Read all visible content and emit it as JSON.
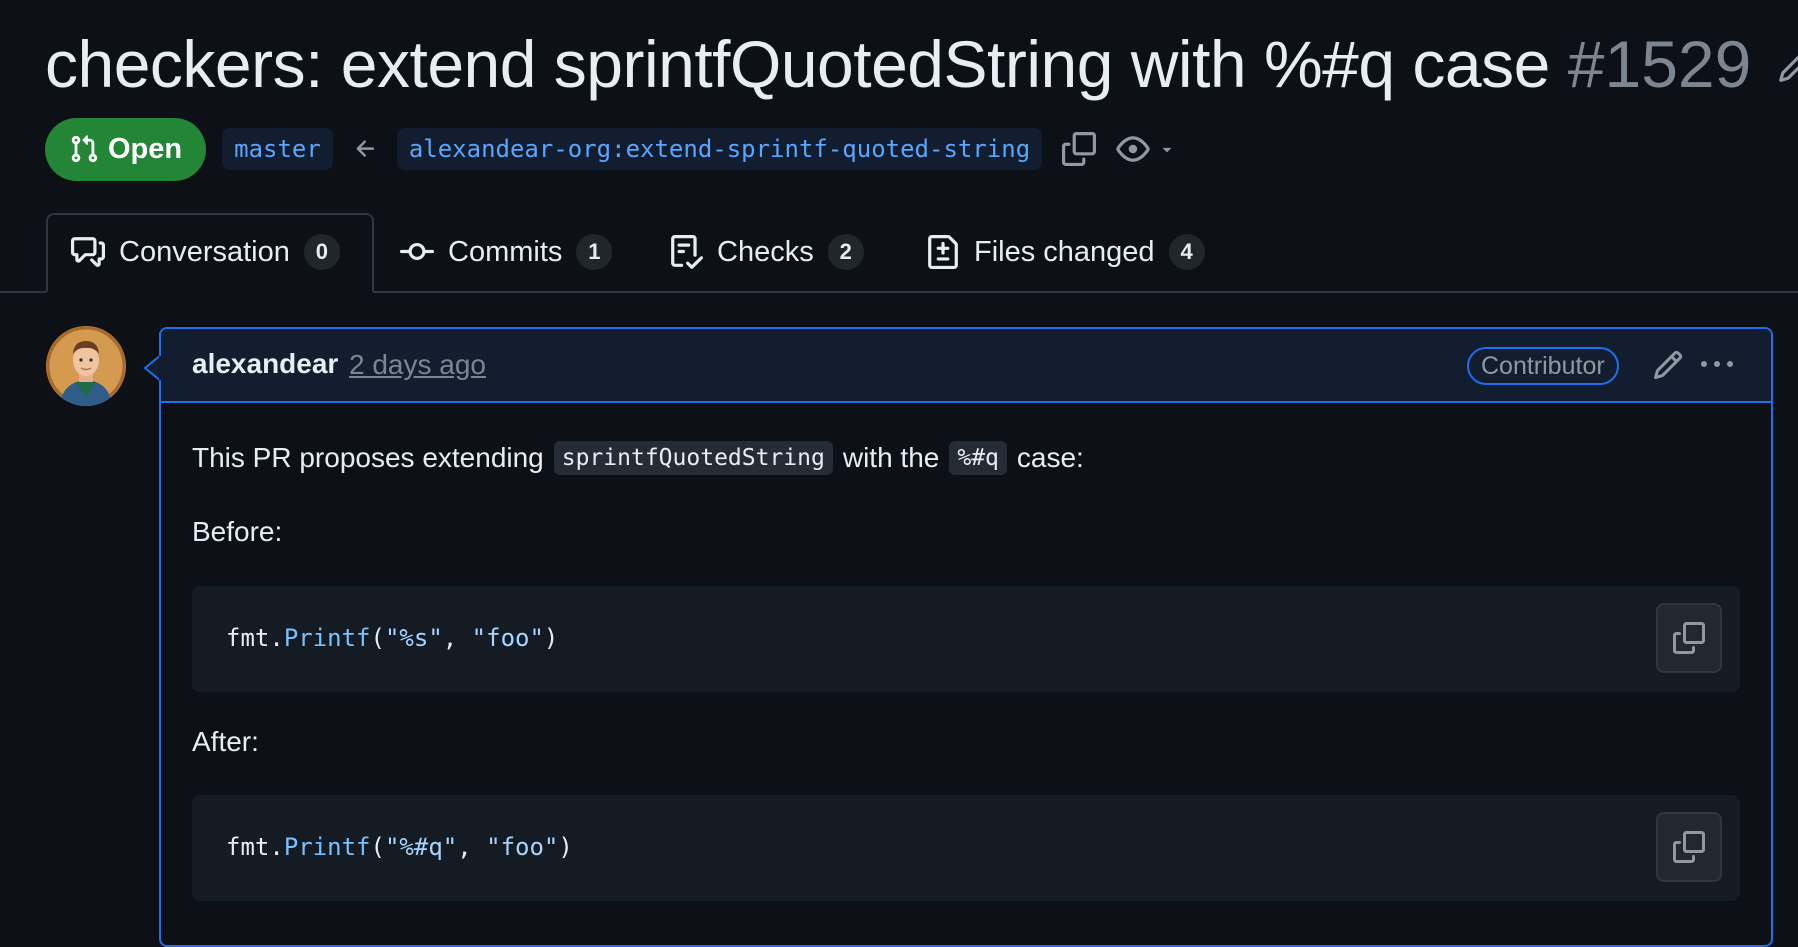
{
  "pr": {
    "title": "checkers: extend sprintfQuotedString with %#q case",
    "number": "#1529",
    "state": "Open",
    "base_branch": "master",
    "head_branch": "alexandear-org:extend-sprintf-quoted-string",
    "state_color": "#238636"
  },
  "tabs": [
    {
      "label": "Conversation",
      "count": "0",
      "icon": "comment-discussion-icon"
    },
    {
      "label": "Commits",
      "count": "1",
      "icon": "git-commit-icon"
    },
    {
      "label": "Checks",
      "count": "2",
      "icon": "checklist-icon"
    },
    {
      "label": "Files changed",
      "count": "4",
      "icon": "file-diff-icon"
    }
  ],
  "comment": {
    "author": "alexandear",
    "timestamp": "2 days ago",
    "role": "Contributor",
    "intro": {
      "pre": "This PR proposes extending",
      "code1": "sprintfQuotedString",
      "mid": "with the",
      "code2": "%#q",
      "post": "case:"
    },
    "before_label": "Before:",
    "after_label": "After:",
    "before_code": {
      "obj": "fmt",
      "dot": ".",
      "fn": "Printf",
      "open": "(",
      "arg1": "\"%s\"",
      "sep": ", ",
      "arg2": "\"foo\"",
      "close": ")"
    },
    "after_code": {
      "obj": "fmt",
      "dot": ".",
      "fn": "Printf",
      "open": "(",
      "arg1": "\"%#q\"",
      "sep": ", ",
      "arg2": "\"foo\"",
      "close": ")"
    }
  },
  "colors": {
    "background": "#0d1117",
    "accent": "#1f6feb",
    "link": "#58a6ff",
    "muted": "#7d8590"
  }
}
